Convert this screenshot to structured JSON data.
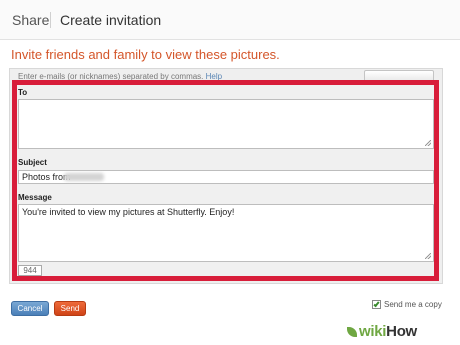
{
  "header": {
    "share_label": "Share",
    "title": "Create invitation"
  },
  "form": {
    "heading": "Invite friends and family to view these pictures.",
    "hint": "Enter e-mails (or nicknames) separated by commas.",
    "help_link": "Help",
    "to_label": "To",
    "to_value": "",
    "subject_label": "Subject",
    "subject_value": "Photos from",
    "message_label": "Message",
    "message_value": "You're invited to view my pictures at Shutterfly. Enjoy!",
    "char_counter": "944"
  },
  "actions": {
    "cancel_label": "Cancel",
    "send_label": "Send",
    "send_copy_label": "Send me a copy",
    "send_copy_checked": true
  },
  "watermark": {
    "wiki": "wiki",
    "how": "How"
  },
  "colors": {
    "highlight": "#d81d3a",
    "heading": "#d4562a",
    "send": "#cf4317",
    "cancel": "#4a7fb8"
  }
}
